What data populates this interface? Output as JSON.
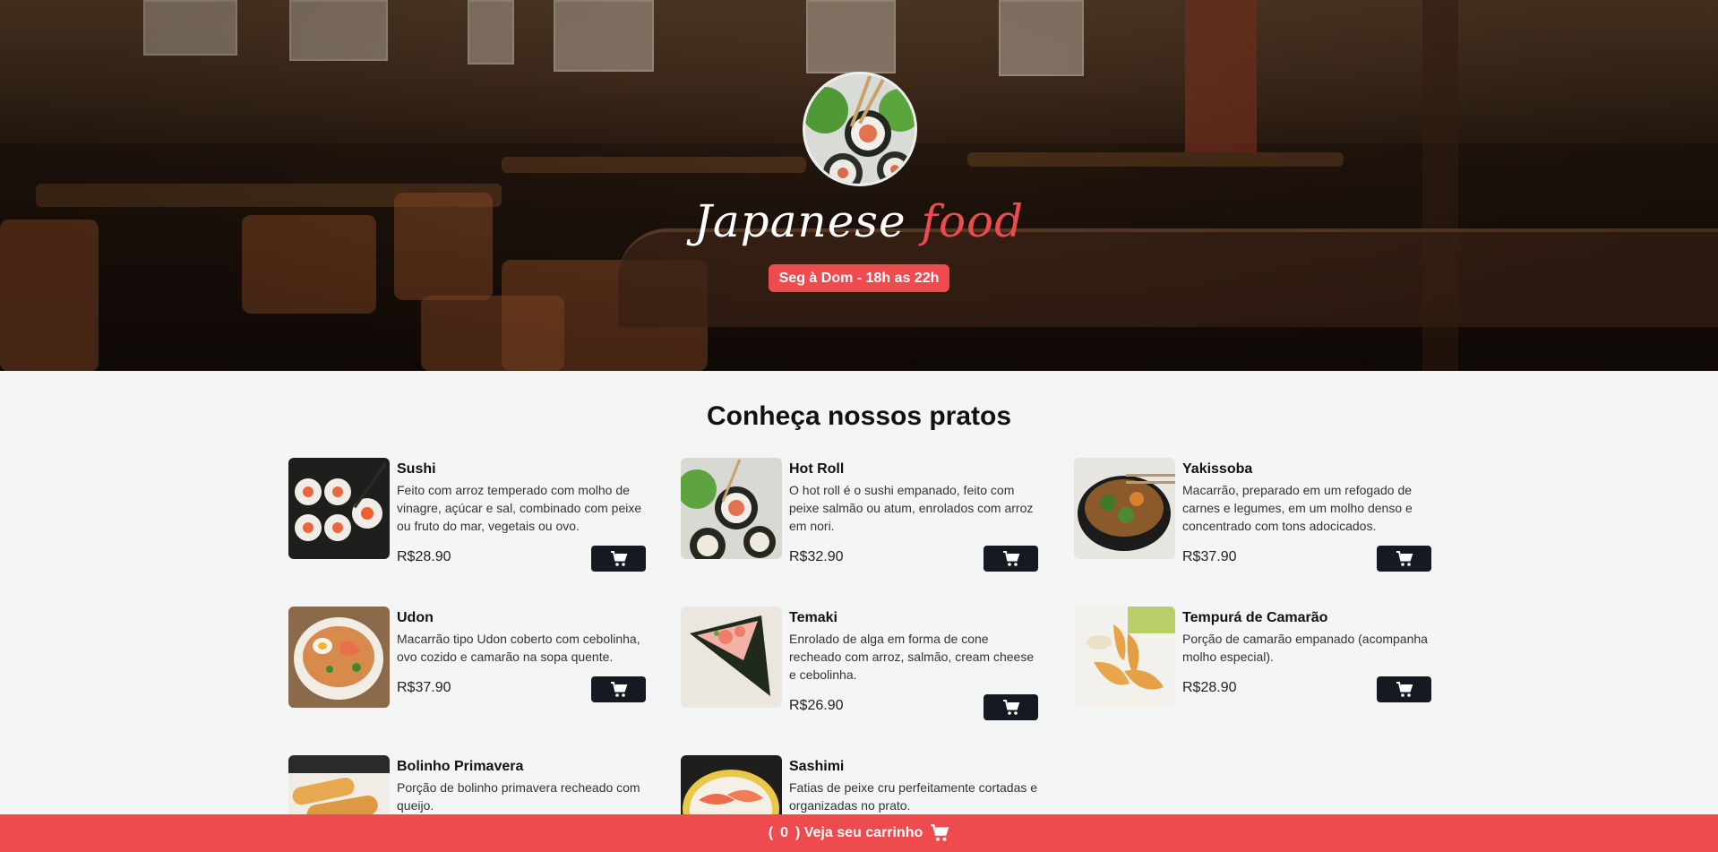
{
  "hero": {
    "brand_main": "Japanese",
    "brand_accent": "food",
    "hours": "Seg à Dom - 18h as 22h"
  },
  "menu": {
    "title": "Conheça nossos pratos",
    "items": [
      {
        "name": "Sushi",
        "description": "Feito com arroz temperado com molho de vinagre, açúcar e sal, combinado com peixe ou fruto do mar, vegetais ou ovo.",
        "price": "R$28.90"
      },
      {
        "name": "Hot Roll",
        "description": "O hot roll é o sushi empanado, feito com peixe salmão ou atum, enrolados com arroz em nori.",
        "price": "R$32.90"
      },
      {
        "name": "Yakissoba",
        "description": "Macarrão, preparado em um refogado de carnes e legumes, em um molho denso e concentrado com tons adocicados.",
        "price": "R$37.90"
      },
      {
        "name": "Udon",
        "description": "Macarrão tipo Udon coberto com cebolinha, ovo cozido e camarão na sopa quente.",
        "price": "R$37.90"
      },
      {
        "name": "Temaki",
        "description": "Enrolado de alga em forma de cone recheado com arroz, salmão, cream cheese e cebolinha.",
        "price": "R$26.90"
      },
      {
        "name": "Tempurá de Camarão",
        "description": "Porção de camarão empanado (acompanha molho especial).",
        "price": "R$28.90"
      },
      {
        "name": "Bolinho Primavera",
        "description": "Porção de bolinho primavera recheado com queijo.",
        "price": ""
      },
      {
        "name": "Sashimi",
        "description": "Fatias de peixe cru perfeitamente cortadas e organizadas no prato.",
        "price": ""
      }
    ]
  },
  "cart": {
    "open_paren": "(",
    "count": "0",
    "label": ") Veja seu carrinho"
  },
  "colors": {
    "accent": "#ee4b4f",
    "button_dark": "#151a22"
  },
  "icons": [
    "cart-icon"
  ]
}
